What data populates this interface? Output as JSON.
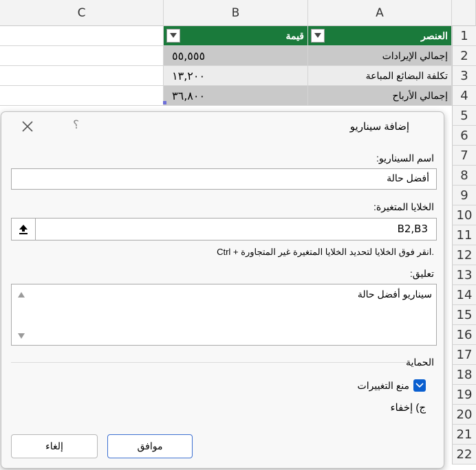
{
  "sheet": {
    "columns": [
      "C",
      "B",
      "A"
    ],
    "rows": [
      "1",
      "2",
      "3",
      "4",
      "5",
      "6",
      "7",
      "8",
      "9",
      "10",
      "11",
      "12",
      "13",
      "14",
      "15",
      "16",
      "17",
      "18",
      "19",
      "20",
      "21",
      "22"
    ],
    "header_row": {
      "col_a": "العنصر",
      "col_b": "قيمة"
    },
    "data": [
      {
        "a": "إجمالي الإيرادات",
        "b": "٥٥,٥٥٥"
      },
      {
        "a": "تكلفة البضائع المباعة",
        "b": "١٣,٢٠٠"
      },
      {
        "a": "إجمالي الأرباح",
        "b": "٣٦,٨٠٠"
      }
    ],
    "colors": {
      "header_green": "#1a7a3b",
      "row_gray": "#c9c9c9",
      "row_light": "#ececec"
    }
  },
  "dialog": {
    "title": "إضافة سيناريو",
    "help_glyph": "؟",
    "close_icon": "close-icon",
    "scenario_name_label": "اسم السيناريو:",
    "scenario_name_value": "أفضل حالة",
    "changing_cells_label": "الخلايا المتغيرة:",
    "changing_cells_value": "B2,B3",
    "ctrl_hint": "Ctrl + انقر فوق الخلايا لتحديد الخلايا المتغيرة غير المتجاورة.",
    "comment_label": "تعليق:",
    "comment_value": "سيناريو أفضل حالة",
    "protection_label": "الحماية",
    "prevent_changes_label": "منع التغييرات",
    "prevent_changes_checked": true,
    "hide_label": "ج) إخفاء",
    "ok_label": "موافق",
    "cancel_label": "إلغاء",
    "accent": "#0a5fd0"
  }
}
